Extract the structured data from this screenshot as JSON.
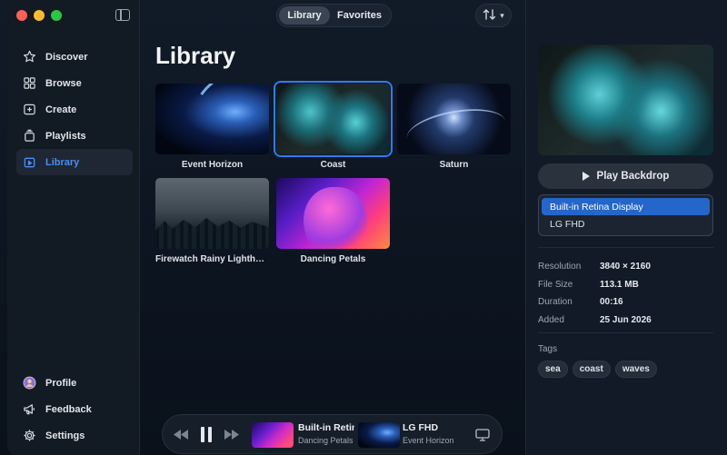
{
  "segmented": {
    "library": "Library",
    "favorites": "Favorites"
  },
  "sort": {
    "icon": "sort-arrows-icon",
    "chevron": "▾"
  },
  "sidebar": {
    "items": [
      {
        "label": "Discover",
        "icon": "star-icon"
      },
      {
        "label": "Browse",
        "icon": "grid-icon"
      },
      {
        "label": "Create",
        "icon": "plus-square-icon"
      },
      {
        "label": "Playlists",
        "icon": "playlists-icon"
      },
      {
        "label": "Library",
        "icon": "library-icon",
        "active": true
      }
    ],
    "bottom": [
      {
        "label": "Profile",
        "icon": "profile-icon"
      },
      {
        "label": "Feedback",
        "icon": "megaphone-icon"
      },
      {
        "label": "Settings",
        "icon": "gear-icon"
      }
    ]
  },
  "main": {
    "title": "Library",
    "tiles": [
      {
        "label": "Event Horizon"
      },
      {
        "label": "Coast",
        "selected": true
      },
      {
        "label": "Saturn"
      },
      {
        "label": "Firewatch Rainy Lighthouse"
      },
      {
        "label": "Dancing Petals"
      }
    ]
  },
  "panel": {
    "play_label": "Play Backdrop",
    "displays": [
      "Built-in Retina Display",
      "LG FHD"
    ],
    "info": [
      {
        "key": "Resolution",
        "value": "3840 × 2160"
      },
      {
        "key": "File Size",
        "value": "113.1 MB"
      },
      {
        "key": "Duration",
        "value": "00:16"
      },
      {
        "key": "Added",
        "value": "25 Jun 2026"
      }
    ],
    "tags_title": "Tags",
    "tags": [
      "sea",
      "coast",
      "waves"
    ]
  },
  "player": {
    "slot1": {
      "display": "Built-in Retina Display",
      "wallpaper": "Dancing Petals"
    },
    "slot2": {
      "display": "LG FHD",
      "wallpaper": "Event Horizon"
    }
  },
  "colors": {
    "accent": "#2f7bf2",
    "sidebar_active_text": "#4b8ef5"
  }
}
